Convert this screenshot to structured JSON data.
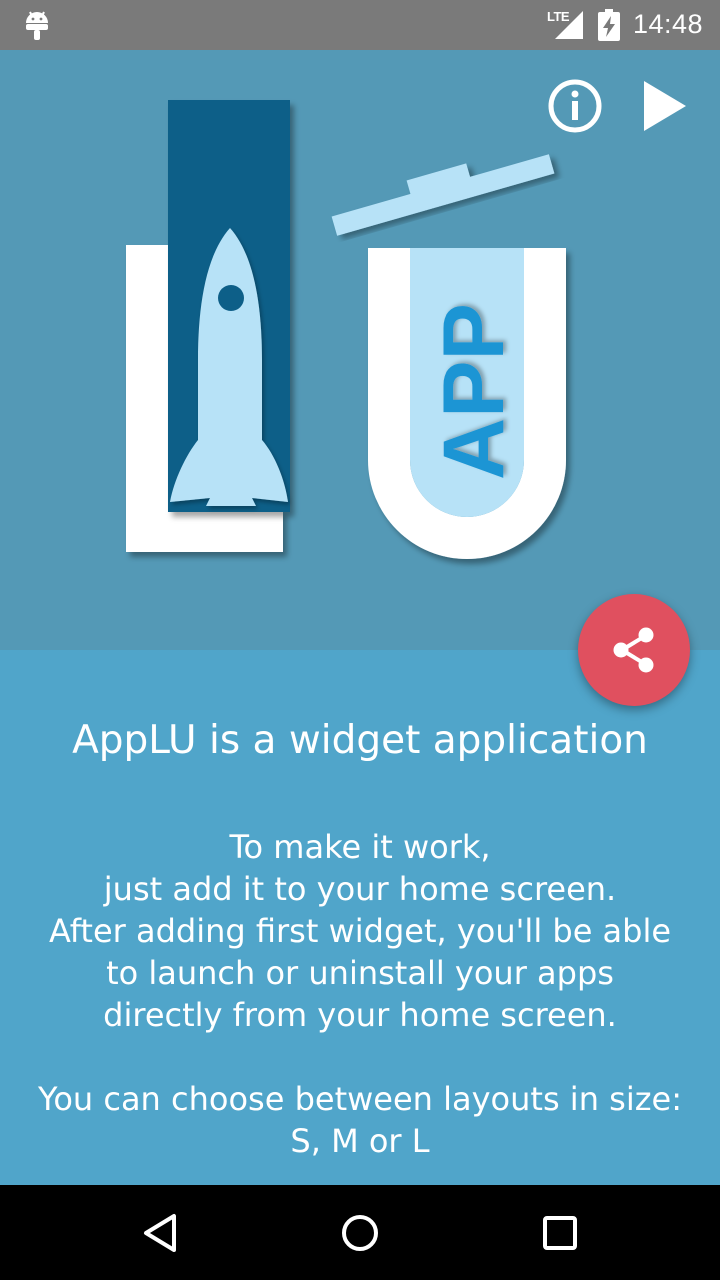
{
  "status_bar": {
    "time": "14:48",
    "network_label": "LTE",
    "icons": [
      "android-icon",
      "signal-icon",
      "battery-charging-icon"
    ]
  },
  "hero": {
    "logo_letters": {
      "left": "L",
      "right": "U",
      "badge": "APP"
    },
    "actions": [
      "info-icon",
      "play-icon"
    ],
    "colors": {
      "background": "#5499b6",
      "bar": "#0f5f88",
      "rocket": "#b7e2f7",
      "letters": "#ffffff",
      "badge_text": "#1f95d4"
    }
  },
  "fab": {
    "icon": "share-icon",
    "color": "#e0505f"
  },
  "content": {
    "background": "#50a5ca",
    "headline": "AppLU is a widget application",
    "body_lines": [
      "To make it work,",
      "just add it to your home screen.",
      "After adding first widget, you'll be able",
      "to launch or uninstall your apps",
      "directly from your home screen."
    ],
    "sizes_lines": [
      "You can choose between layouts in size:",
      "S, M or L"
    ]
  },
  "nav_bar": {
    "buttons": [
      "back-icon",
      "home-icon",
      "recents-icon"
    ]
  }
}
